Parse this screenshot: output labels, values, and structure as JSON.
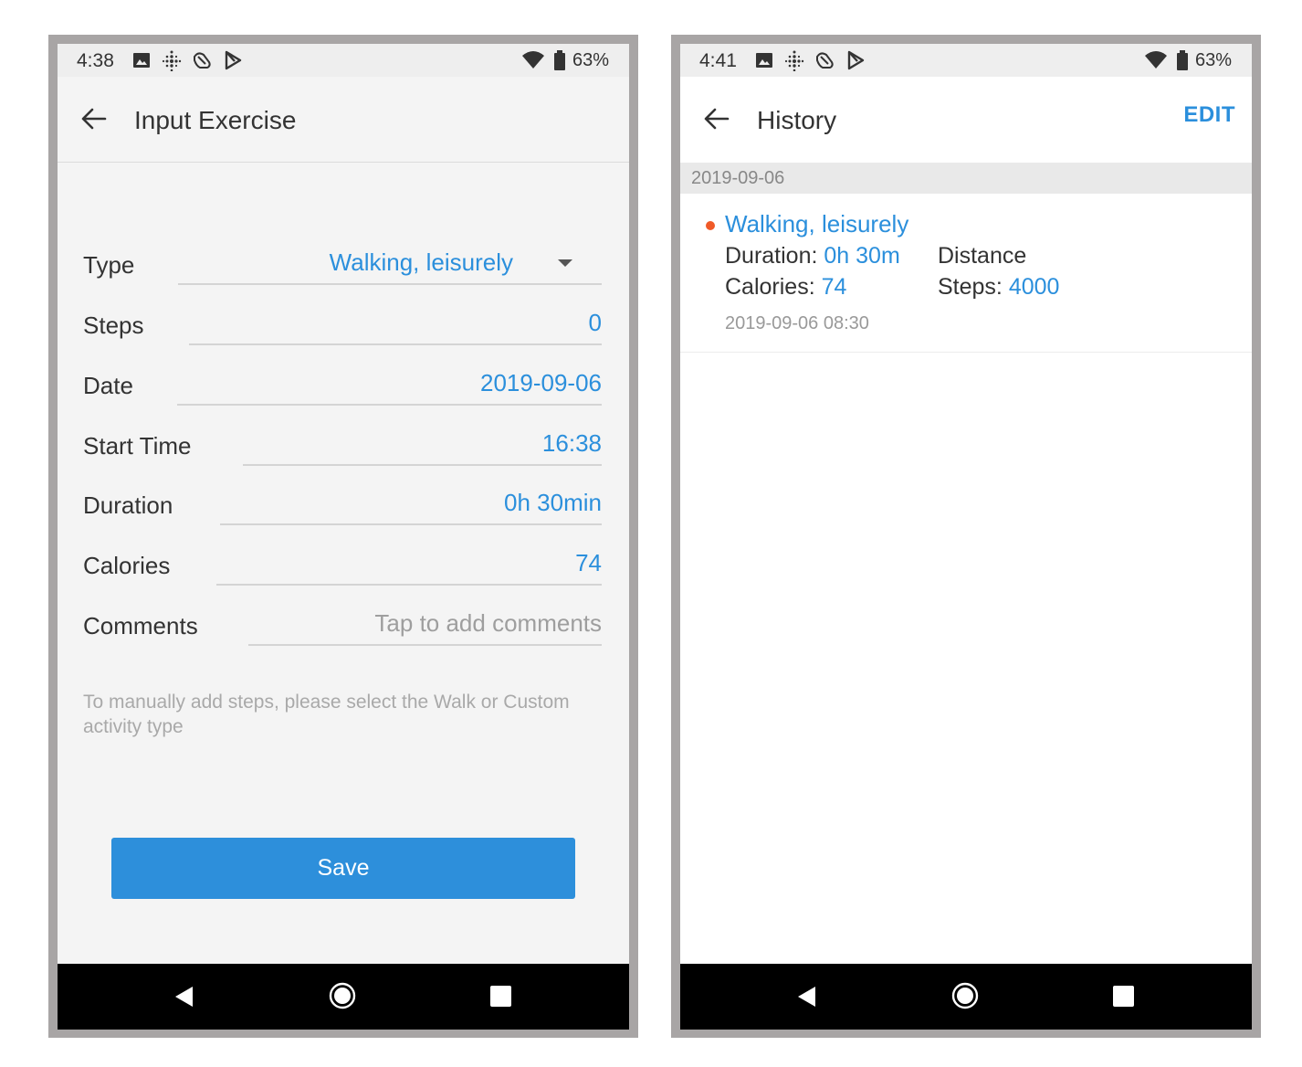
{
  "left_screen": {
    "status": {
      "time": "4:38",
      "battery": "63%"
    },
    "title": "Input Exercise",
    "form": {
      "type_label": "Type",
      "type_value": "Walking, leisurely",
      "steps_label": "Steps",
      "steps_value": "0",
      "date_label": "Date",
      "date_value": "2019-09-06",
      "start_label": "Start Time",
      "start_value": "16:38",
      "duration_label": "Duration",
      "duration_value": "0h 30min",
      "calories_label": "Calories",
      "calories_value": "74",
      "comments_label": "Comments",
      "comments_placeholder": "Tap to add comments"
    },
    "hint": "To manually add steps, please select the Walk or Custom activity type",
    "save_label": "Save"
  },
  "right_screen": {
    "status": {
      "time": "4:41",
      "battery": "63%"
    },
    "title": "History",
    "edit_label": "EDIT",
    "section_date": "2019-09-06",
    "entry": {
      "title": "Walking, leisurely",
      "duration_label": "Duration: ",
      "duration_value": "0h 30m",
      "distance_label": "Distance",
      "calories_label": "Calories: ",
      "calories_value": "74",
      "steps_label": "Steps: ",
      "steps_value": "4000",
      "datetime": "2019-09-06 08:30",
      "dot_color": "#f05a28"
    }
  },
  "icons": {
    "status_left": [
      "image-icon",
      "fitbit-icon",
      "pedometer-icon",
      "play-store-icon"
    ],
    "status_right": [
      "wifi-icon",
      "battery-icon"
    ],
    "nav": [
      "nav-back-icon",
      "nav-home-icon",
      "nav-recents-icon"
    ]
  },
  "colors": {
    "accent": "#2b8fdc",
    "save_button": "#2d8fdb",
    "frame": "#a8a5a5",
    "dot": "#f05a28"
  }
}
